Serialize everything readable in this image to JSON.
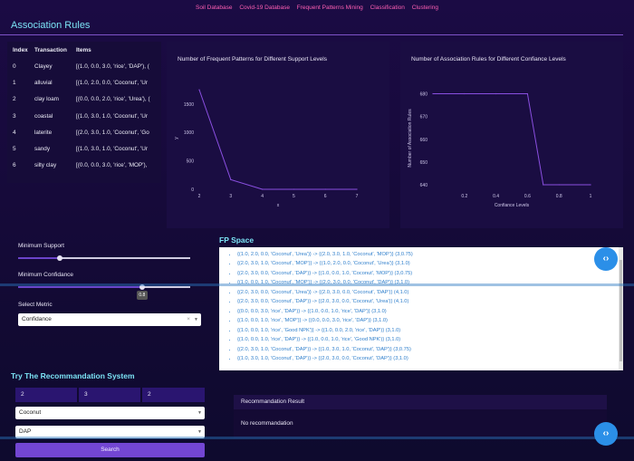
{
  "nav": [
    "Soil Database",
    "Covid-19 Database",
    "Frequent Patterns Mining",
    "Classification",
    "Clustering"
  ],
  "page_title": "Association Rules",
  "table": {
    "headers": [
      "Index",
      "Transaction",
      "Items"
    ],
    "rows": [
      [
        "0",
        "Clayey",
        "[(1.0, 0.0, 3.0, 'rice', 'DAP'), ("
      ],
      [
        "1",
        "alluvial",
        "[(1.0, 2.0, 0.0, 'Coconut', 'Ur"
      ],
      [
        "2",
        "clay loam",
        "[(0.0, 0.0, 2.0, 'rice', 'Urea'), ("
      ],
      [
        "3",
        "coastal",
        "[(1.0, 3.0, 1.0, 'Coconut', 'Ur"
      ],
      [
        "4",
        "laterite",
        "[(2.0, 3.0, 1.0, 'Coconut', 'Go"
      ],
      [
        "5",
        "sandy",
        "[(1.0, 3.0, 1.0, 'Coconut', 'Ur"
      ],
      [
        "6",
        "silty clay",
        "[(0.0, 0.0, 3.0, 'rice', 'MOP'),"
      ]
    ]
  },
  "chart_data": [
    {
      "type": "line",
      "title": "Number of Frequent Patterns for Different Support Levels",
      "xlabel": "x",
      "ylabel": "y",
      "x": [
        2,
        3,
        4,
        5,
        6,
        7
      ],
      "y": [
        1750,
        170,
        0,
        0,
        0,
        0
      ],
      "xlim": [
        2,
        7
      ],
      "ylim": [
        0,
        1800
      ],
      "xticks": [
        "2",
        "3",
        "4",
        "5",
        "6",
        "7"
      ],
      "yticks": [
        0,
        500,
        1000,
        1500
      ],
      "line_color": "#8a4fe0"
    },
    {
      "type": "line",
      "title": "Number of Association Rules for Different Confiance Levels",
      "xlabel": "Confiance Levels",
      "ylabel": "Number of Association Rules",
      "x": [
        0,
        0.2,
        0.4,
        0.6,
        0.7,
        0.8,
        1.0
      ],
      "y": [
        680,
        680,
        680,
        680,
        640,
        640,
        640
      ],
      "xlim": [
        0,
        1
      ],
      "ylim": [
        638,
        683
      ],
      "xticks": [
        "0.2",
        "0.4",
        "0.6",
        "0.8",
        "1"
      ],
      "xtick_values": [
        0.2,
        0.4,
        0.6,
        0.8,
        1.0
      ],
      "yticks": [
        640,
        650,
        660,
        670,
        680
      ],
      "ytick_labels": [
        "640",
        "650",
        "660",
        "670",
        "680"
      ],
      "line_color": "#8a4fe0"
    }
  ],
  "controls": {
    "min_support_label": "Minimum Support",
    "min_support_value": 0.24,
    "min_confidence_label": "Minimum Confidance",
    "min_confidence_value": 0.72,
    "min_confidence_tooltip": "0.8",
    "metric_label": "Select Metric",
    "metric_value": "Confidance",
    "clear_glyph": "×",
    "chevron_glyph": "▼"
  },
  "fp_space": {
    "title": "FP Space",
    "items": [
      "{(1.0, 2.0, 0.0, 'Coconut', 'Urea')} -> {(2.0, 3.0, 1.0, 'Coconut', 'MOP')} (3,0.75)",
      "{(2.0, 3.0, 1.0, 'Coconut', 'MOP')} -> {(1.0, 2.0, 0.0, 'Coconut', 'Urea')} (3,1.0)",
      "{(2.0, 3.0, 0.0, 'Coconut', 'DAP')} -> {(1.0, 0.0, 1.0, 'Coconut', 'MOP')} (3,0.75)",
      "{(1.0, 0.0, 1.0, 'Coconut', 'MOP')} -> {(2.0, 3.0, 0.0, 'Coconut', 'DAP')} (3,1.0)",
      "{(2.0, 3.0, 0.0, 'Coconut', 'Urea')} -> {(2.0, 3.0, 0.0, 'Coconut', 'DAP')} (4,1.0)",
      "{(2.0, 3.0, 0.0, 'Coconut', 'DAP')} -> {(2.0, 3.0, 0.0, 'Coconut', 'Urea')} (4,1.0)",
      "{(0.0, 0.0, 3.0, 'rice', 'DAP')} -> {(1.0, 0.0, 1.0, 'rice', 'DAP')} (3,1.0)",
      "{(1.0, 0.0, 1.0, 'rice', 'MOP')} -> {(0.0, 0.0, 3.0, 'rice', 'DAP')} (3,1.0)",
      "{(1.0, 0.0, 1.0, 'rice', 'Good NPK')} -> {(1.0, 0.0, 2.0, 'rice', 'DAP')} (3,1.0)",
      "{(1.0, 0.0, 1.0, 'rice', 'DAP')} -> {(1.0, 0.0, 1.0, 'rice', 'Good NPK')} (3,1.0)",
      "{(2.0, 3.0, 1.0, 'Coconut', 'DAP')} -> {(1.0, 3.0, 1.0, 'Coconut', 'DAP')} (3,0.75)",
      "{(1.0, 3.0, 1.0, 'Coconut', 'DAP')} -> {(2.0, 3.0, 0.0, 'Coconut', 'DAP')} (3,1.0)"
    ]
  },
  "recommendation": {
    "title": "Try The Recommandation System",
    "inputs": [
      "2",
      "3",
      "2"
    ],
    "crop_value": "Coconut",
    "fertilizer_value": "DAP",
    "search_label": "Search",
    "result_header": "Recommandation Result",
    "result_value": "No recommandation"
  },
  "nav_button_glyph": "‹›",
  "colors": {
    "accent": "#7be3f5",
    "nav_link": "#ff5fb4",
    "button": "#7346d3",
    "fp_text": "#2f7fcc",
    "nav_button": "#2b8fe8"
  }
}
